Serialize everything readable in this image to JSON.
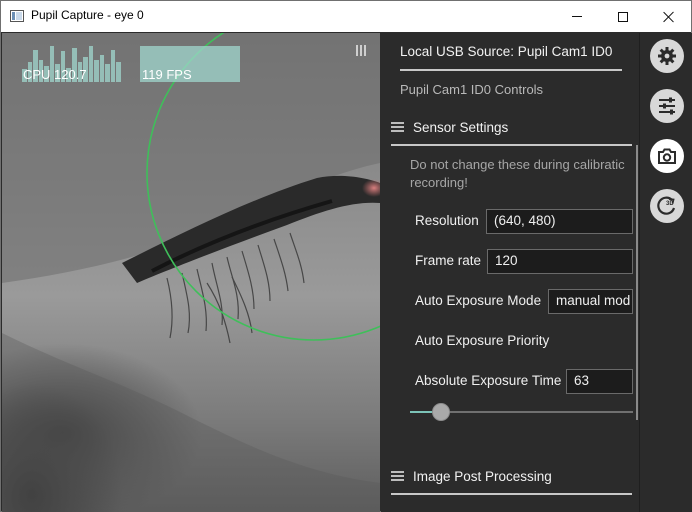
{
  "window": {
    "title": "Pupil Capture - eye 0"
  },
  "overlay": {
    "cpu_label": "CPU 120.7",
    "fps_label": "119 FPS",
    "cpu_history": [
      0.35,
      0.55,
      0.9,
      0.6,
      0.45,
      1.0,
      0.5,
      0.85,
      0.4,
      0.95,
      0.55,
      0.7,
      1.0,
      0.6,
      0.75,
      0.5,
      0.9,
      0.55
    ],
    "fps_level": 1.0,
    "graph_color": "#a0d7cd",
    "ellipse_color": "#3fbf5a"
  },
  "panel": {
    "source_title": "Local USB Source: Pupil Cam1 ID0",
    "controls_title": "Pupil Cam1 ID0 Controls",
    "sensor": {
      "title": "Sensor Settings",
      "note_line1": "Do not change these during calibratic",
      "note_line2": "recording!",
      "resolution_label": "Resolution",
      "resolution_value": "(640, 480)",
      "frame_rate_label": "Frame rate",
      "frame_rate_value": "120",
      "auto_exposure_mode_label": "Auto Exposure Mode",
      "auto_exposure_mode_value": "manual mod",
      "auto_exposure_priority_label": "Auto Exposure Priority",
      "absolute_exposure_label": "Absolute Exposure Time",
      "absolute_exposure_value": "63",
      "exposure_slider_fraction": 0.14
    },
    "post_processing": {
      "title": "Image Post Processing"
    },
    "accent_color": "#7cc3b8"
  },
  "iconbar": {
    "items": [
      {
        "icon": "gear-icon"
      },
      {
        "icon": "sliders-icon"
      },
      {
        "icon": "camera-icon",
        "active": true
      },
      {
        "icon": "rotate-3d-icon",
        "badge": "3D"
      }
    ]
  }
}
